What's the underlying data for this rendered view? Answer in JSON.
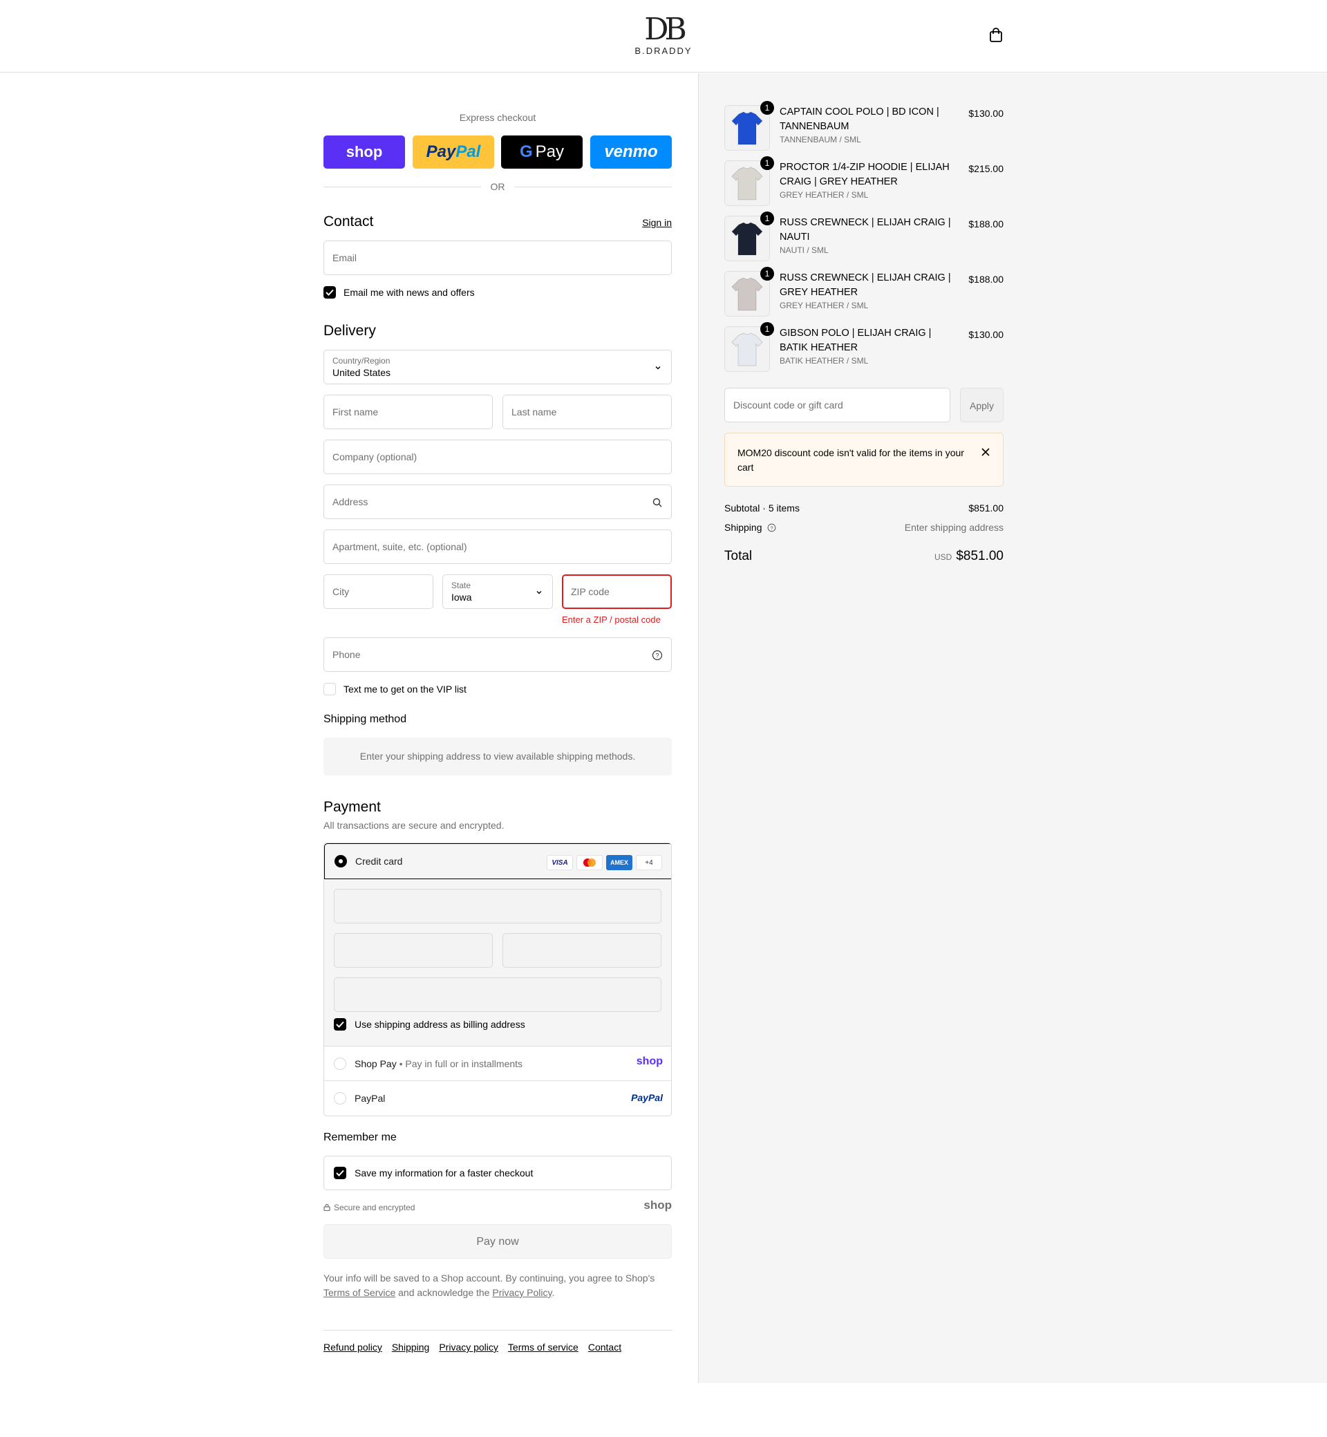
{
  "brand": {
    "name": "B.DRADDY",
    "mark": "DB"
  },
  "express": {
    "title": "Express checkout",
    "shop": "shop",
    "paypal": "PayPal",
    "gpay": "Pay",
    "venmo": "venmo",
    "or": "OR"
  },
  "contact": {
    "title": "Contact",
    "sign_in": "Sign in",
    "email_placeholder": "Email",
    "news_label": "Email me with news and offers"
  },
  "delivery": {
    "title": "Delivery",
    "country_label": "Country/Region",
    "country_value": "United States",
    "first_name": "First name",
    "last_name": "Last name",
    "company": "Company (optional)",
    "address": "Address",
    "apartment": "Apartment, suite, etc. (optional)",
    "city": "City",
    "state_label": "State",
    "state_value": "Iowa",
    "zip": "ZIP code",
    "zip_error": "Enter a ZIP / postal code",
    "phone": "Phone",
    "vip_label": "Text me to get on the VIP list"
  },
  "shipping_method": {
    "title": "Shipping method",
    "notice": "Enter your shipping address to view available shipping methods."
  },
  "payment": {
    "title": "Payment",
    "subtitle": "All transactions are secure and encrypted.",
    "credit_card": "Credit card",
    "cards": [
      "VISA",
      "MC",
      "AMEX",
      "+4"
    ],
    "billing_label": "Use shipping address as billing address",
    "shop_pay": "Shop Pay",
    "shop_pay_sub": "Pay in full or in installments",
    "shop_logo": "shop",
    "paypal": "PayPal",
    "paypal_logo": "PayPal"
  },
  "remember": {
    "title": "Remember me",
    "save_label": "Save my information for a faster checkout",
    "secure": "Secure and encrypted",
    "shop_logo": "shop"
  },
  "pay_now": "Pay now",
  "legal": {
    "text1": "Your info will be saved to a Shop account. By continuing, you agree to Shop's",
    "terms": "Terms of Service",
    "text2": "and acknowledge the",
    "privacy": "Privacy Policy",
    "text3": "."
  },
  "footer": [
    "Refund policy",
    "Shipping",
    "Privacy policy",
    "Terms of service",
    "Contact"
  ],
  "cart": {
    "items": [
      {
        "name": "CAPTAIN COOL POLO | BD ICON | TANNENBAUM",
        "variant": "TANNENBAUM / SML",
        "price": "$130.00",
        "qty": "1",
        "color": "#1f4fd1"
      },
      {
        "name": "PROCTOR 1/4-ZIP HOODIE | ELIJAH CRAIG | GREY HEATHER",
        "variant": "GREY HEATHER / SML",
        "price": "$215.00",
        "qty": "1",
        "color": "#d9d6cf"
      },
      {
        "name": "RUSS CREWNECK | ELIJAH CRAIG | NAUTI",
        "variant": "NAUTI / SML",
        "price": "$188.00",
        "qty": "1",
        "color": "#1b2233"
      },
      {
        "name": "RUSS CREWNECK | ELIJAH CRAIG | GREY HEATHER",
        "variant": "GREY HEATHER / SML",
        "price": "$188.00",
        "qty": "1",
        "color": "#cfc7c5"
      },
      {
        "name": "GIBSON POLO | ELIJAH CRAIG | BATIK HEATHER",
        "variant": "BATIK HEATHER / SML",
        "price": "$130.00",
        "qty": "1",
        "color": "#e6e9ef"
      }
    ],
    "discount_placeholder": "Discount code or gift card",
    "apply": "Apply",
    "alert": "MOM20 discount code isn't valid for the items in your cart",
    "subtotal_label": "Subtotal · 5 items",
    "subtotal_value": "$851.00",
    "shipping_label": "Shipping",
    "shipping_value": "Enter shipping address",
    "total_label": "Total",
    "currency": "USD",
    "total_value": "$851.00"
  }
}
